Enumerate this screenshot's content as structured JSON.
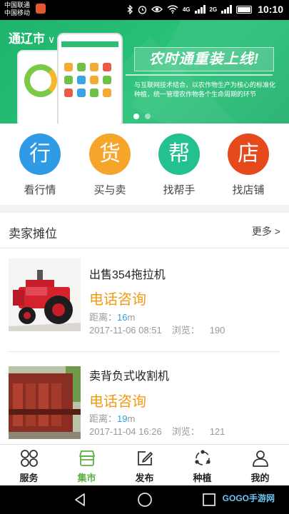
{
  "status_bar": {
    "carrier_1": "中国联通",
    "carrier_2": "中国移动",
    "network_1": "4G",
    "network_2": "2G",
    "time": "10:10",
    "icons": [
      "app-notification-icon",
      "bluetooth-icon",
      "alarm-icon",
      "eye-icon",
      "wifi-icon",
      "signal-icon",
      "battery-icon"
    ]
  },
  "banner": {
    "city": "通辽市",
    "city_chevron": "∨",
    "slogan": "农时通重装上线!",
    "description": "与互联网技术结合，以农作物生产为核心的标准化种植，统一管理农作物各个生命周期的环节",
    "active_slide": 1,
    "slide_count": 2,
    "colors": {
      "background": "#22b46e"
    }
  },
  "categories": [
    {
      "glyph": "行",
      "label": "看行情",
      "color": "#2f9be6"
    },
    {
      "glyph": "货",
      "label": "买与卖",
      "color": "#f6a52b"
    },
    {
      "glyph": "帮",
      "label": "找帮手",
      "color": "#22c18f"
    },
    {
      "glyph": "店",
      "label": "找店铺",
      "color": "#e6491b"
    }
  ],
  "sellers": {
    "title": "卖家摊位",
    "more": "更多 >",
    "items": [
      {
        "title": "出售354拖拉机",
        "contact": "电话咨询",
        "distance_label": "距离：",
        "distance_value": "16",
        "distance_unit": "m",
        "date": "2017-11-06 08:51",
        "views_label": "浏览：",
        "views": "190"
      },
      {
        "title": "卖背负式收割机",
        "contact": "电话咨询",
        "distance_label": "距离：",
        "distance_value": "19",
        "distance_unit": "m",
        "date": "2017-11-04 16:26",
        "views_label": "浏览：",
        "views": "121"
      }
    ]
  },
  "tabbar": {
    "tabs": [
      {
        "label": "服务",
        "icon": "grid-icon"
      },
      {
        "label": "集市",
        "icon": "store-icon"
      },
      {
        "label": "发布",
        "icon": "edit-icon"
      },
      {
        "label": "种植",
        "icon": "cycle-icon"
      },
      {
        "label": "我的",
        "icon": "user-icon"
      }
    ],
    "active": "集市",
    "colors": {
      "active": "#5bb043"
    }
  },
  "nav_bar": {
    "watermark": "GOGO手游网",
    "icons": [
      "back-icon",
      "home-icon",
      "recents-icon"
    ]
  }
}
